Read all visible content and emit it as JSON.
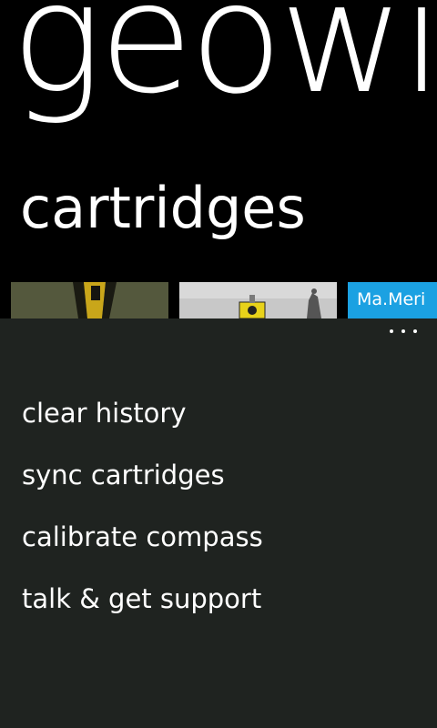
{
  "app": {
    "title": "geowi",
    "page_title": "cartridges"
  },
  "cartridges": [
    {
      "label": "",
      "icon": "cartridge-thumbnail-green"
    },
    {
      "label": "",
      "icon": "cartridge-thumbnail-yellow-sign"
    },
    {
      "label": "Ma.Meri",
      "color": "#1ba1e2"
    }
  ],
  "app_bar": {
    "more_icon": "ellipsis-icon",
    "menu": [
      "clear history",
      "sync cartridges",
      "calibrate compass",
      "talk & get support"
    ]
  },
  "colors": {
    "background": "#000000",
    "app_bar": "#1f2320",
    "accent": "#1ba1e2",
    "text": "#ffffff"
  }
}
